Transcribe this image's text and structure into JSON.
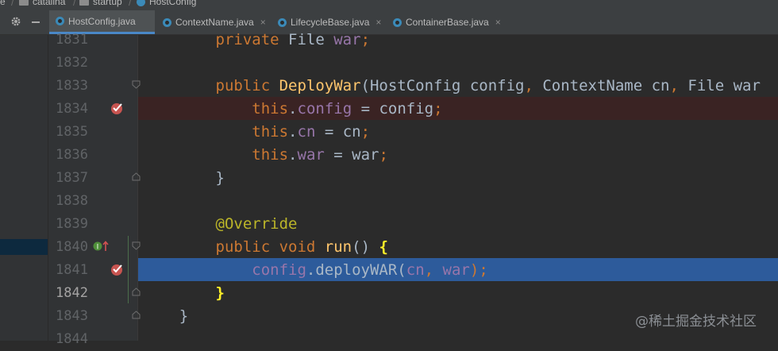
{
  "breadcrumb": {
    "items": [
      "catalina",
      "startup",
      "HostConfig"
    ],
    "lead": "e"
  },
  "tabs": [
    {
      "label": "HostConfig.java",
      "active": true
    },
    {
      "label": "ContextName.java",
      "active": false
    },
    {
      "label": "LifecycleBase.java",
      "active": false
    },
    {
      "label": "ContainerBase.java",
      "active": false
    }
  ],
  "tab_close_glyph": "×",
  "line_numbers": [
    "1831",
    "1832",
    "1833",
    "1834",
    "1835",
    "1836",
    "1837",
    "1838",
    "1839",
    "1840",
    "1841",
    "1842",
    "1843",
    "1844"
  ],
  "code": {
    "l1831": {
      "kw": "private ",
      "type": "File ",
      "field": "war",
      "end": ";"
    },
    "l1833": {
      "kw": "public ",
      "method": "DeployWar",
      "args": "(HostConfig config",
      "c1": ", ",
      "a2": "ContextName cn",
      "c2": ", ",
      "a3": "File war"
    },
    "l1834": {
      "kw": "this",
      "dot": ".",
      "field": "config",
      "rest": " = config",
      "end": ";"
    },
    "l1835": {
      "kw": "this",
      "dot": ".",
      "field": "cn",
      "rest": " = cn",
      "end": ";"
    },
    "l1836": {
      "kw": "this",
      "dot": ".",
      "field": "war",
      "rest": " = war",
      "end": ";"
    },
    "l1837": {
      "brace": "}"
    },
    "l1839": {
      "annotation": "@Override"
    },
    "l1840": {
      "kw": "public void ",
      "method": "run",
      "parens": "() ",
      "brace": "{"
    },
    "l1841": {
      "obj": "config",
      "call": ".deployWAR(",
      "a1": "cn",
      "comma": ", ",
      "a2": "war",
      "end": ");"
    },
    "l1842": {
      "brace": "}"
    },
    "l1843": {
      "brace": "}"
    }
  },
  "watermark": "@稀土掘金技术社区",
  "colors": {
    "background": "#2b2b2b",
    "keyword": "#cc7832",
    "field": "#9876aa",
    "method": "#ffc66d",
    "annotation": "#bbb529",
    "breakpoint": "#c75450",
    "execution_line": "#2d5b9b",
    "breakpoint_line": "#3a2323"
  }
}
